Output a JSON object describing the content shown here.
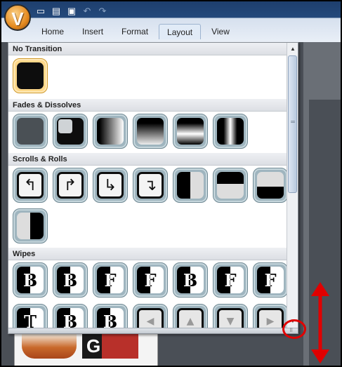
{
  "app": {
    "logo_letter": "V"
  },
  "quick_access": [
    {
      "icon": "new-file-icon",
      "glyph": "▭"
    },
    {
      "icon": "open-folder-icon",
      "glyph": "▤"
    },
    {
      "icon": "save-icon",
      "glyph": "▣"
    },
    {
      "icon": "undo-icon",
      "glyph": "↶"
    },
    {
      "icon": "redo-icon",
      "glyph": "↷"
    }
  ],
  "ribbon": {
    "tabs": [
      "Home",
      "Insert",
      "Format",
      "Layout",
      "View"
    ],
    "active_tab": "Layout"
  },
  "gallery": {
    "sections": {
      "no_transition": "No Transition",
      "fades": "Fades & Dissolves",
      "scrolls": "Scrolls & Rolls",
      "wipes": "Wipes"
    },
    "wipe_letters": [
      "B",
      "B",
      "F",
      "F",
      "B",
      "F",
      "F"
    ],
    "wipe2_letters": [
      "T",
      "B",
      "B"
    ],
    "scroll_arrows": [
      "↰",
      "↱",
      "↳",
      "↴"
    ]
  },
  "colors": {
    "accent_red": "#e00000",
    "selected_tile": "#ffd88a",
    "tile": "#9fb5bf"
  }
}
